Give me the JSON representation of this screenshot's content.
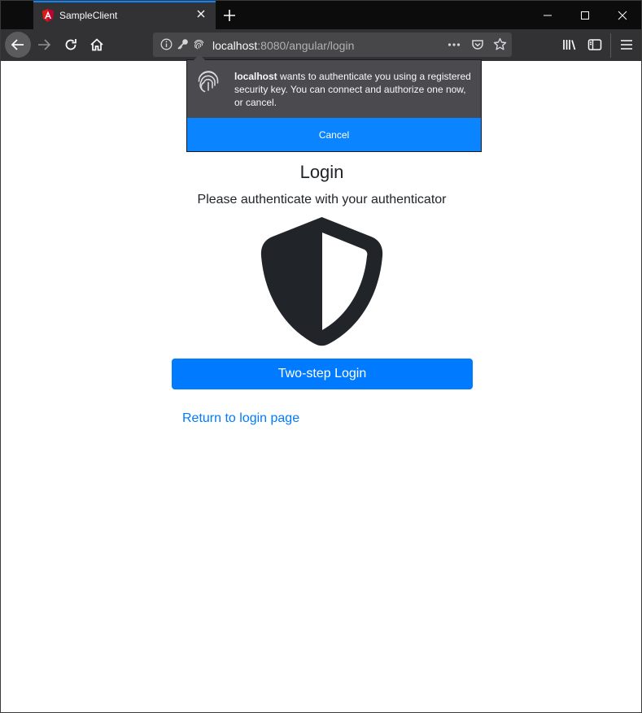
{
  "browser": {
    "tab_title": "SampleClient",
    "url_host": "localhost",
    "url_rest": ":8080/angular/login",
    "accent": "#0a84ff"
  },
  "popup": {
    "host": "localhost",
    "message": " wants to authenticate you using a registered security key. You can connect and authorize one now, or cancel.",
    "cancel_label": "Cancel",
    "icon": "fingerprint-icon"
  },
  "page": {
    "title": "Login",
    "subtitle": "Please authenticate with your authenticator",
    "primary_button": "Two-step Login",
    "return_link": "Return to login page",
    "icon": "shield-icon",
    "primary_color": "#007bff",
    "text_color": "#212529"
  }
}
